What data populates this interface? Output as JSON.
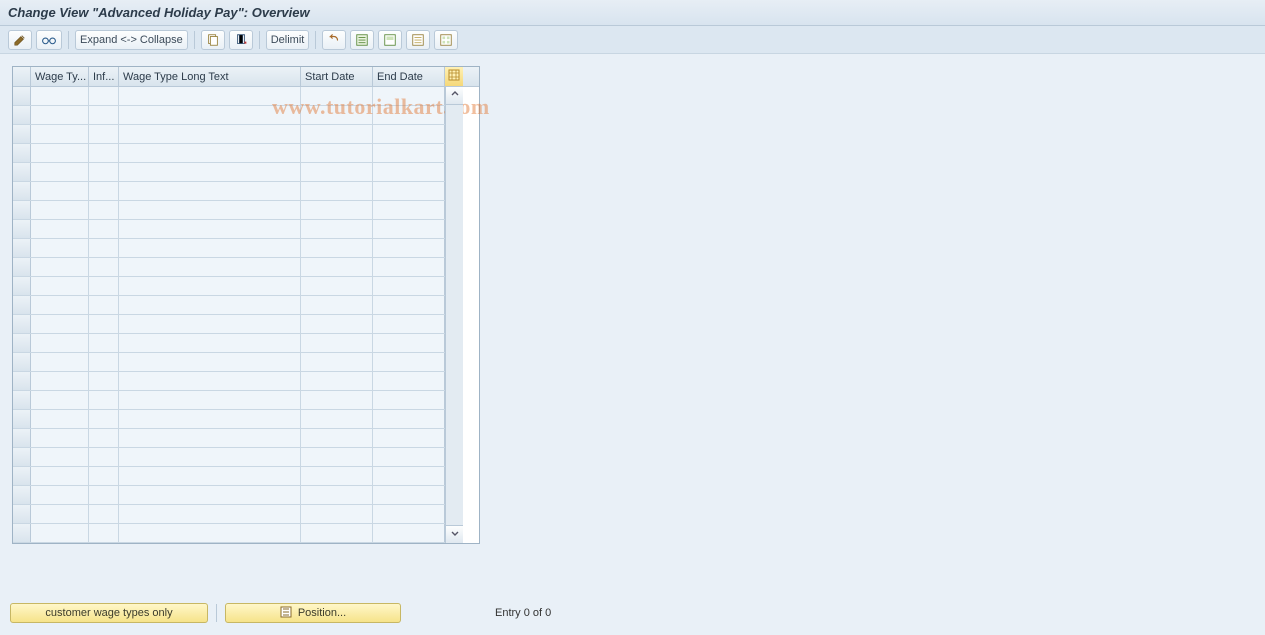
{
  "header": {
    "title": "Change View \"Advanced Holiday Pay\": Overview"
  },
  "toolbar": {
    "expand_collapse_label": "Expand <-> Collapse",
    "delimit_label": "Delimit"
  },
  "table": {
    "columns": {
      "wage_type": "Wage Ty...",
      "inf": "Inf...",
      "long_text": "Wage Type Long Text",
      "start_date": "Start Date",
      "end_date": "End Date"
    },
    "row_count": 24,
    "rows": []
  },
  "footer": {
    "customer_wage_types_label": "customer wage types only",
    "position_label": "Position...",
    "entry_label": "Entry 0 of 0"
  },
  "watermark": "www.tutorialkart.com"
}
